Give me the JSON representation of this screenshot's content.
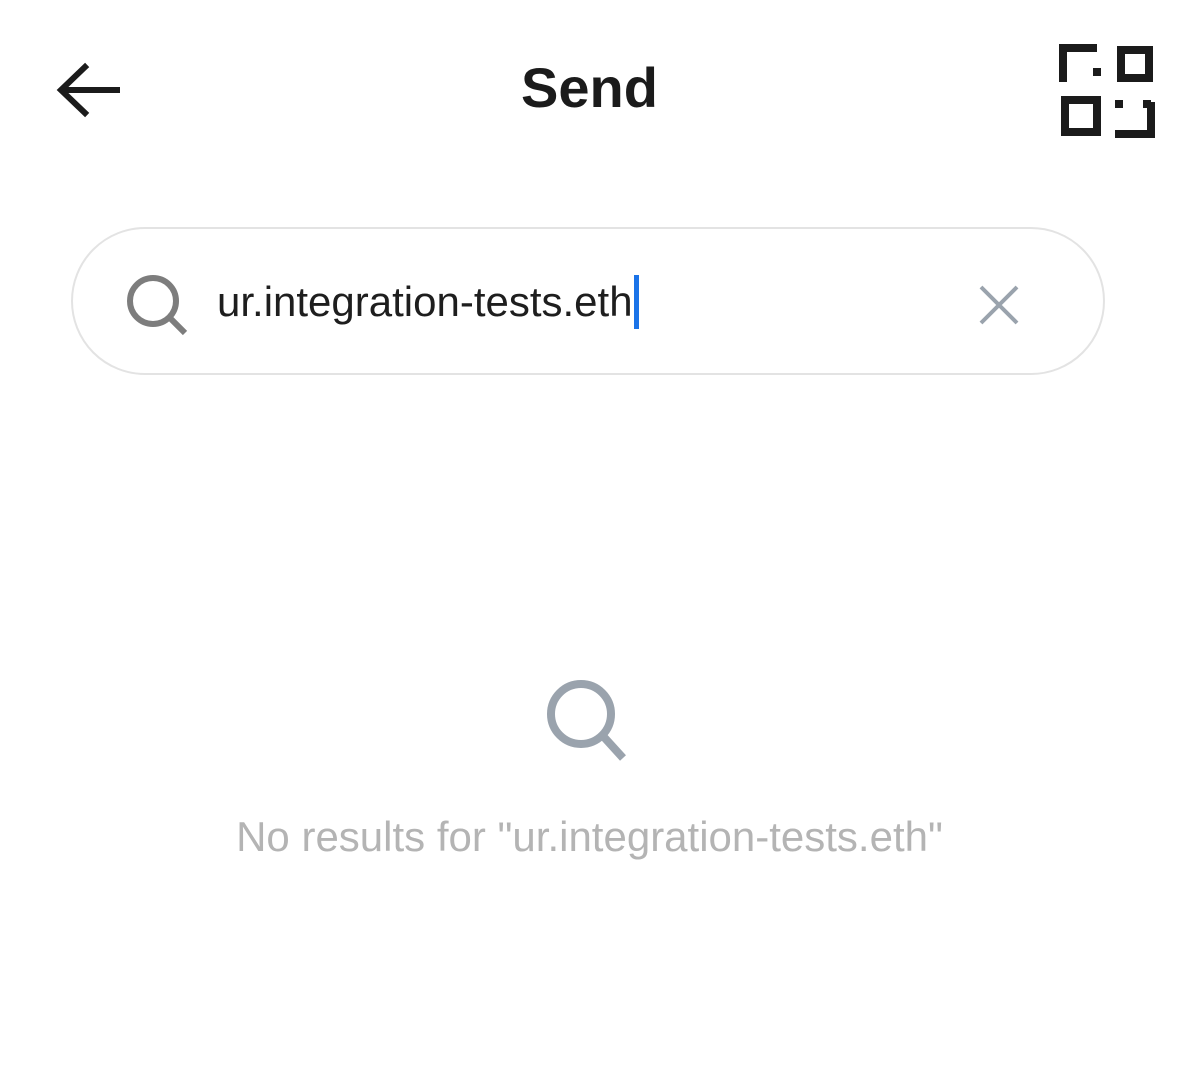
{
  "header": {
    "title": "Send",
    "back_icon": "arrow-left-icon",
    "scan_icon": "qr-scan-icon"
  },
  "search": {
    "value": "ur.integration-tests.eth",
    "placeholder": "",
    "search_icon": "search-icon",
    "clear_icon": "close-icon",
    "caret_color": "#1a73e8"
  },
  "empty_state": {
    "icon": "search-icon",
    "message": "No results for \"ur.integration-tests.eth\""
  },
  "colors": {
    "title": "#1b1b1b",
    "muted_text": "#b4b4b4",
    "icon_gray": "#9aa3ad",
    "border": "#e3e3e3"
  }
}
